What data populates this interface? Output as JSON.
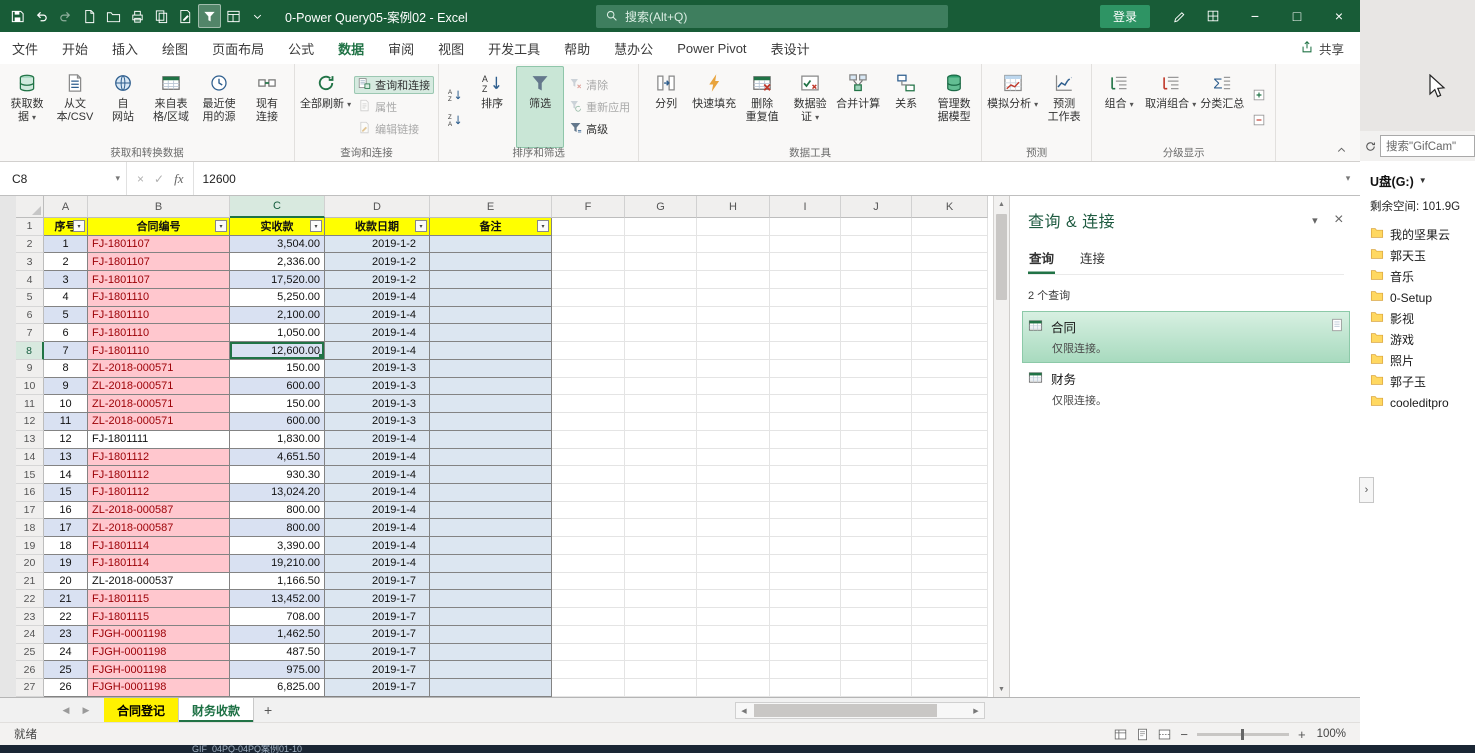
{
  "titlebar": {
    "title": "0-Power Query05-案例02 - Excel",
    "search_placeholder": "搜索(Alt+Q)",
    "login_label": "登录",
    "quick_access": [
      "save",
      "undo",
      "redo",
      "new-file",
      "open-folder",
      "print",
      "copy",
      "edit-doc",
      "filter",
      "window",
      "more-commands"
    ]
  },
  "menu": {
    "tabs": [
      "文件",
      "开始",
      "插入",
      "绘图",
      "页面布局",
      "公式",
      "数据",
      "审阅",
      "视图",
      "开发工具",
      "帮助",
      "慧办公",
      "Power Pivot",
      "表设计"
    ],
    "active": "数据",
    "share_label": "共享"
  },
  "ribbon": {
    "groups": [
      {
        "label": "获取和转换数据",
        "items": [
          {
            "t": "large",
            "name": "get-data",
            "label": "获取数\n据",
            "icon": "get-data",
            "arrow": true
          },
          {
            "t": "large",
            "name": "from-text-csv",
            "label": "从文\n本/CSV",
            "icon": "from-text-csv"
          },
          {
            "t": "large",
            "name": "from-web",
            "label": "自\n网站",
            "icon": "from-web"
          },
          {
            "t": "large",
            "name": "from-table-range",
            "label": "来自表\n格/区域",
            "icon": "from-table-range"
          },
          {
            "t": "large",
            "name": "recent-sources",
            "label": "最近使\n用的源",
            "icon": "recent-sources"
          },
          {
            "t": "large",
            "name": "existing-connections",
            "label": "现有\n连接",
            "icon": "existing-connections"
          }
        ]
      },
      {
        "label": "查询和连接",
        "items": [
          {
            "t": "large",
            "name": "refresh-all",
            "label": "全部刷新",
            "icon": "refresh-all",
            "arrow": true
          },
          {
            "t": "stack",
            "items": [
              {
                "name": "queries-connections",
                "label": "查询和连接",
                "icon": "queries-connections",
                "boxed": true
              },
              {
                "name": "properties",
                "label": "属性",
                "icon": "properties",
                "disabled": true
              },
              {
                "name": "edit-links",
                "label": "编辑链接",
                "icon": "edit-links",
                "disabled": true
              }
            ]
          }
        ]
      },
      {
        "label": "排序和筛选",
        "items": [
          {
            "t": "stack2",
            "items": [
              {
                "name": "sort-ascending",
                "icon": "sort-asc"
              },
              {
                "name": "sort-descending",
                "icon": "sort-desc"
              }
            ]
          },
          {
            "t": "large",
            "name": "sort",
            "label": "排序",
            "icon": "sort-asc"
          },
          {
            "t": "large",
            "name": "filter",
            "label": "筛选",
            "icon": "filter",
            "highlight": true
          },
          {
            "t": "stack",
            "items": [
              {
                "name": "clear-filter",
                "label": "清除",
                "icon": "clear-filter",
                "disabled": true
              },
              {
                "name": "reapply-filter",
                "label": "重新应用",
                "icon": "reapply-filter",
                "disabled": true
              },
              {
                "name": "advanced-filter",
                "label": "高级",
                "icon": "advanced-filter"
              }
            ]
          }
        ]
      },
      {
        "label": "数据工具",
        "items": [
          {
            "t": "large",
            "name": "text-to-columns",
            "label": "分列",
            "icon": "text-to-columns"
          },
          {
            "t": "large",
            "name": "flash-fill",
            "label": "快速填充",
            "icon": "flash-fill"
          },
          {
            "t": "large",
            "name": "remove-duplicates",
            "label": "删除\n重复值",
            "icon": "remove-duplicates"
          },
          {
            "t": "large",
            "name": "data-validation",
            "label": "数据验\n证",
            "icon": "data-validation",
            "arrow": true
          },
          {
            "t": "large",
            "name": "consolidate",
            "label": "合并计算",
            "icon": "consolidate"
          },
          {
            "t": "large",
            "name": "relationships",
            "label": "关系",
            "icon": "relationships"
          },
          {
            "t": "large",
            "name": "manage-data-model",
            "label": "管理数\n据模型",
            "icon": "manage-data-model"
          }
        ]
      },
      {
        "label": "预测",
        "items": [
          {
            "t": "large",
            "name": "what-if-analysis",
            "label": "模拟分析",
            "icon": "what-if-analysis",
            "arrow": true
          },
          {
            "t": "large",
            "name": "forecast-sheet",
            "label": "预测\n工作表",
            "icon": "forecast-sheet"
          }
        ]
      },
      {
        "label": "分级显示",
        "items": [
          {
            "t": "large",
            "name": "group",
            "label": "组合",
            "icon": "group",
            "arrow": true
          },
          {
            "t": "large",
            "name": "ungroup",
            "label": "取消组合",
            "icon": "ungroup",
            "arrow": true
          },
          {
            "t": "large",
            "name": "subtotal",
            "label": "分类汇总",
            "icon": "subtotal"
          },
          {
            "t": "stack2",
            "items": [
              {
                "name": "show-detail",
                "icon": "show-detail"
              },
              {
                "name": "hide-detail",
                "icon": "hide-detail"
              }
            ]
          }
        ]
      }
    ]
  },
  "formula_bar": {
    "name_box": "C8",
    "value": "12600",
    "fx_label": "fx"
  },
  "sheet": {
    "visible_columns": [
      "A",
      "B",
      "C",
      "D",
      "E",
      "F",
      "G",
      "H",
      "I",
      "J",
      "K"
    ],
    "active_cell": "C8",
    "header_row": [
      "序号",
      "合同编号",
      "实收款",
      "收款日期",
      "备注"
    ],
    "rows": [
      {
        "n": "1",
        "contract": "FJ-1801107",
        "amount": "3,504.00",
        "date": "2019-1-2",
        "duplicate": true
      },
      {
        "n": "2",
        "contract": "FJ-1801107",
        "amount": "2,336.00",
        "date": "2019-1-2",
        "duplicate": true
      },
      {
        "n": "3",
        "contract": "FJ-1801107",
        "amount": "17,520.00",
        "date": "2019-1-2",
        "duplicate": true
      },
      {
        "n": "4",
        "contract": "FJ-1801110",
        "amount": "5,250.00",
        "date": "2019-1-4",
        "duplicate": true
      },
      {
        "n": "5",
        "contract": "FJ-1801110",
        "amount": "2,100.00",
        "date": "2019-1-4",
        "duplicate": true
      },
      {
        "n": "6",
        "contract": "FJ-1801110",
        "amount": "1,050.00",
        "date": "2019-1-4",
        "duplicate": true
      },
      {
        "n": "7",
        "contract": "FJ-1801110",
        "amount": "12,600.00",
        "date": "2019-1-4",
        "duplicate": true
      },
      {
        "n": "8",
        "contract": "ZL-2018-000571",
        "amount": "150.00",
        "date": "2019-1-3",
        "duplicate": true
      },
      {
        "n": "9",
        "contract": "ZL-2018-000571",
        "amount": "600.00",
        "date": "2019-1-3",
        "duplicate": true
      },
      {
        "n": "10",
        "contract": "ZL-2018-000571",
        "amount": "150.00",
        "date": "2019-1-3",
        "duplicate": true
      },
      {
        "n": "11",
        "contract": "ZL-2018-000571",
        "amount": "600.00",
        "date": "2019-1-3",
        "duplicate": true
      },
      {
        "n": "12",
        "contract": "FJ-1801111",
        "amount": "1,830.00",
        "date": "2019-1-4",
        "duplicate": false
      },
      {
        "n": "13",
        "contract": "FJ-1801112",
        "amount": "4,651.50",
        "date": "2019-1-4",
        "duplicate": true
      },
      {
        "n": "14",
        "contract": "FJ-1801112",
        "amount": "930.30",
        "date": "2019-1-4",
        "duplicate": true
      },
      {
        "n": "15",
        "contract": "FJ-1801112",
        "amount": "13,024.20",
        "date": "2019-1-4",
        "duplicate": true
      },
      {
        "n": "16",
        "contract": "ZL-2018-000587",
        "amount": "800.00",
        "date": "2019-1-4",
        "duplicate": true
      },
      {
        "n": "17",
        "contract": "ZL-2018-000587",
        "amount": "800.00",
        "date": "2019-1-4",
        "duplicate": true
      },
      {
        "n": "18",
        "contract": "FJ-1801114",
        "amount": "3,390.00",
        "date": "2019-1-4",
        "duplicate": true
      },
      {
        "n": "19",
        "contract": "FJ-1801114",
        "amount": "19,210.00",
        "date": "2019-1-4",
        "duplicate": true
      },
      {
        "n": "20",
        "contract": "ZL-2018-000537",
        "amount": "1,166.50",
        "date": "2019-1-7",
        "duplicate": false
      },
      {
        "n": "21",
        "contract": "FJ-1801115",
        "amount": "13,452.00",
        "date": "2019-1-7",
        "duplicate": true
      },
      {
        "n": "22",
        "contract": "FJ-1801115",
        "amount": "708.00",
        "date": "2019-1-7",
        "duplicate": true
      },
      {
        "n": "23",
        "contract": "FJGH-0001198",
        "amount": "1,462.50",
        "date": "2019-1-7",
        "duplicate": true
      },
      {
        "n": "24",
        "contract": "FJGH-0001198",
        "amount": "487.50",
        "date": "2019-1-7",
        "duplicate": true
      },
      {
        "n": "25",
        "contract": "FJGH-0001198",
        "amount": "975.00",
        "date": "2019-1-7",
        "duplicate": true
      },
      {
        "n": "26",
        "contract": "FJGH-0001198",
        "amount": "6,825.00",
        "date": "2019-1-7",
        "duplicate": true
      }
    ]
  },
  "sheet_tabs": {
    "tabs": [
      {
        "label": "合同登记",
        "highlight": "yellow",
        "active": false
      },
      {
        "label": "财务收款",
        "active": true
      }
    ]
  },
  "query_pane": {
    "title": "查询 & 连接",
    "tabs": [
      {
        "label": "查询",
        "active": true
      },
      {
        "label": "连接",
        "active": false
      }
    ],
    "count_label": "2 个查询",
    "items": [
      {
        "name": "合同",
        "detail": "仅限连接。",
        "selected": true
      },
      {
        "name": "财务",
        "detail": "仅限连接。",
        "selected": false
      }
    ]
  },
  "file_panel": {
    "search_text": "搜索\"GifCam\"",
    "drive_label": "U盘(G:)",
    "free_space": "剩余空间: 101.9G",
    "folders": [
      "我的坚果云",
      "郭天玉",
      "音乐",
      "0-Setup",
      "影视",
      "游戏",
      "照片",
      "郭子玉",
      "cooleditpro"
    ]
  },
  "status_bar": {
    "ready_label": "就绪",
    "zoom_label": "100%"
  },
  "taskbar": {
    "item_label": "GIF_04PQ-04PQ案例01-10"
  }
}
